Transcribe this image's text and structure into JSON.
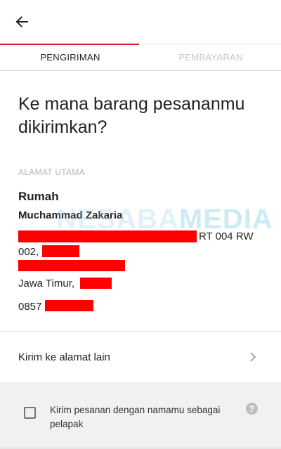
{
  "tabs": [
    {
      "label": "PENGIRIMAN",
      "active": true
    },
    {
      "label": "PEMBAYARAN",
      "active": false
    }
  ],
  "heading": "Ke mana barang pesananmu dikirimkan?",
  "address": {
    "section_label": "ALAMAT UTAMA",
    "label": "Rumah",
    "recipient": "Muchammad Zakaria",
    "line1_suffix": "RT 004 RW",
    "line2_prefix": "002,",
    "line4_prefix": "Jawa Timur,",
    "phone_prefix": "0857"
  },
  "watermark": {
    "part1": "NESABA",
    "part2": "MEDIA"
  },
  "other_address": {
    "label": "Kirim ke alamat lain"
  },
  "dropship": {
    "label": "Kirim pesanan dengan namamu sebagai pelapak",
    "checked": false,
    "help": "?"
  },
  "colors": {
    "accent": "#e0203a",
    "redaction": "#ff0000"
  }
}
